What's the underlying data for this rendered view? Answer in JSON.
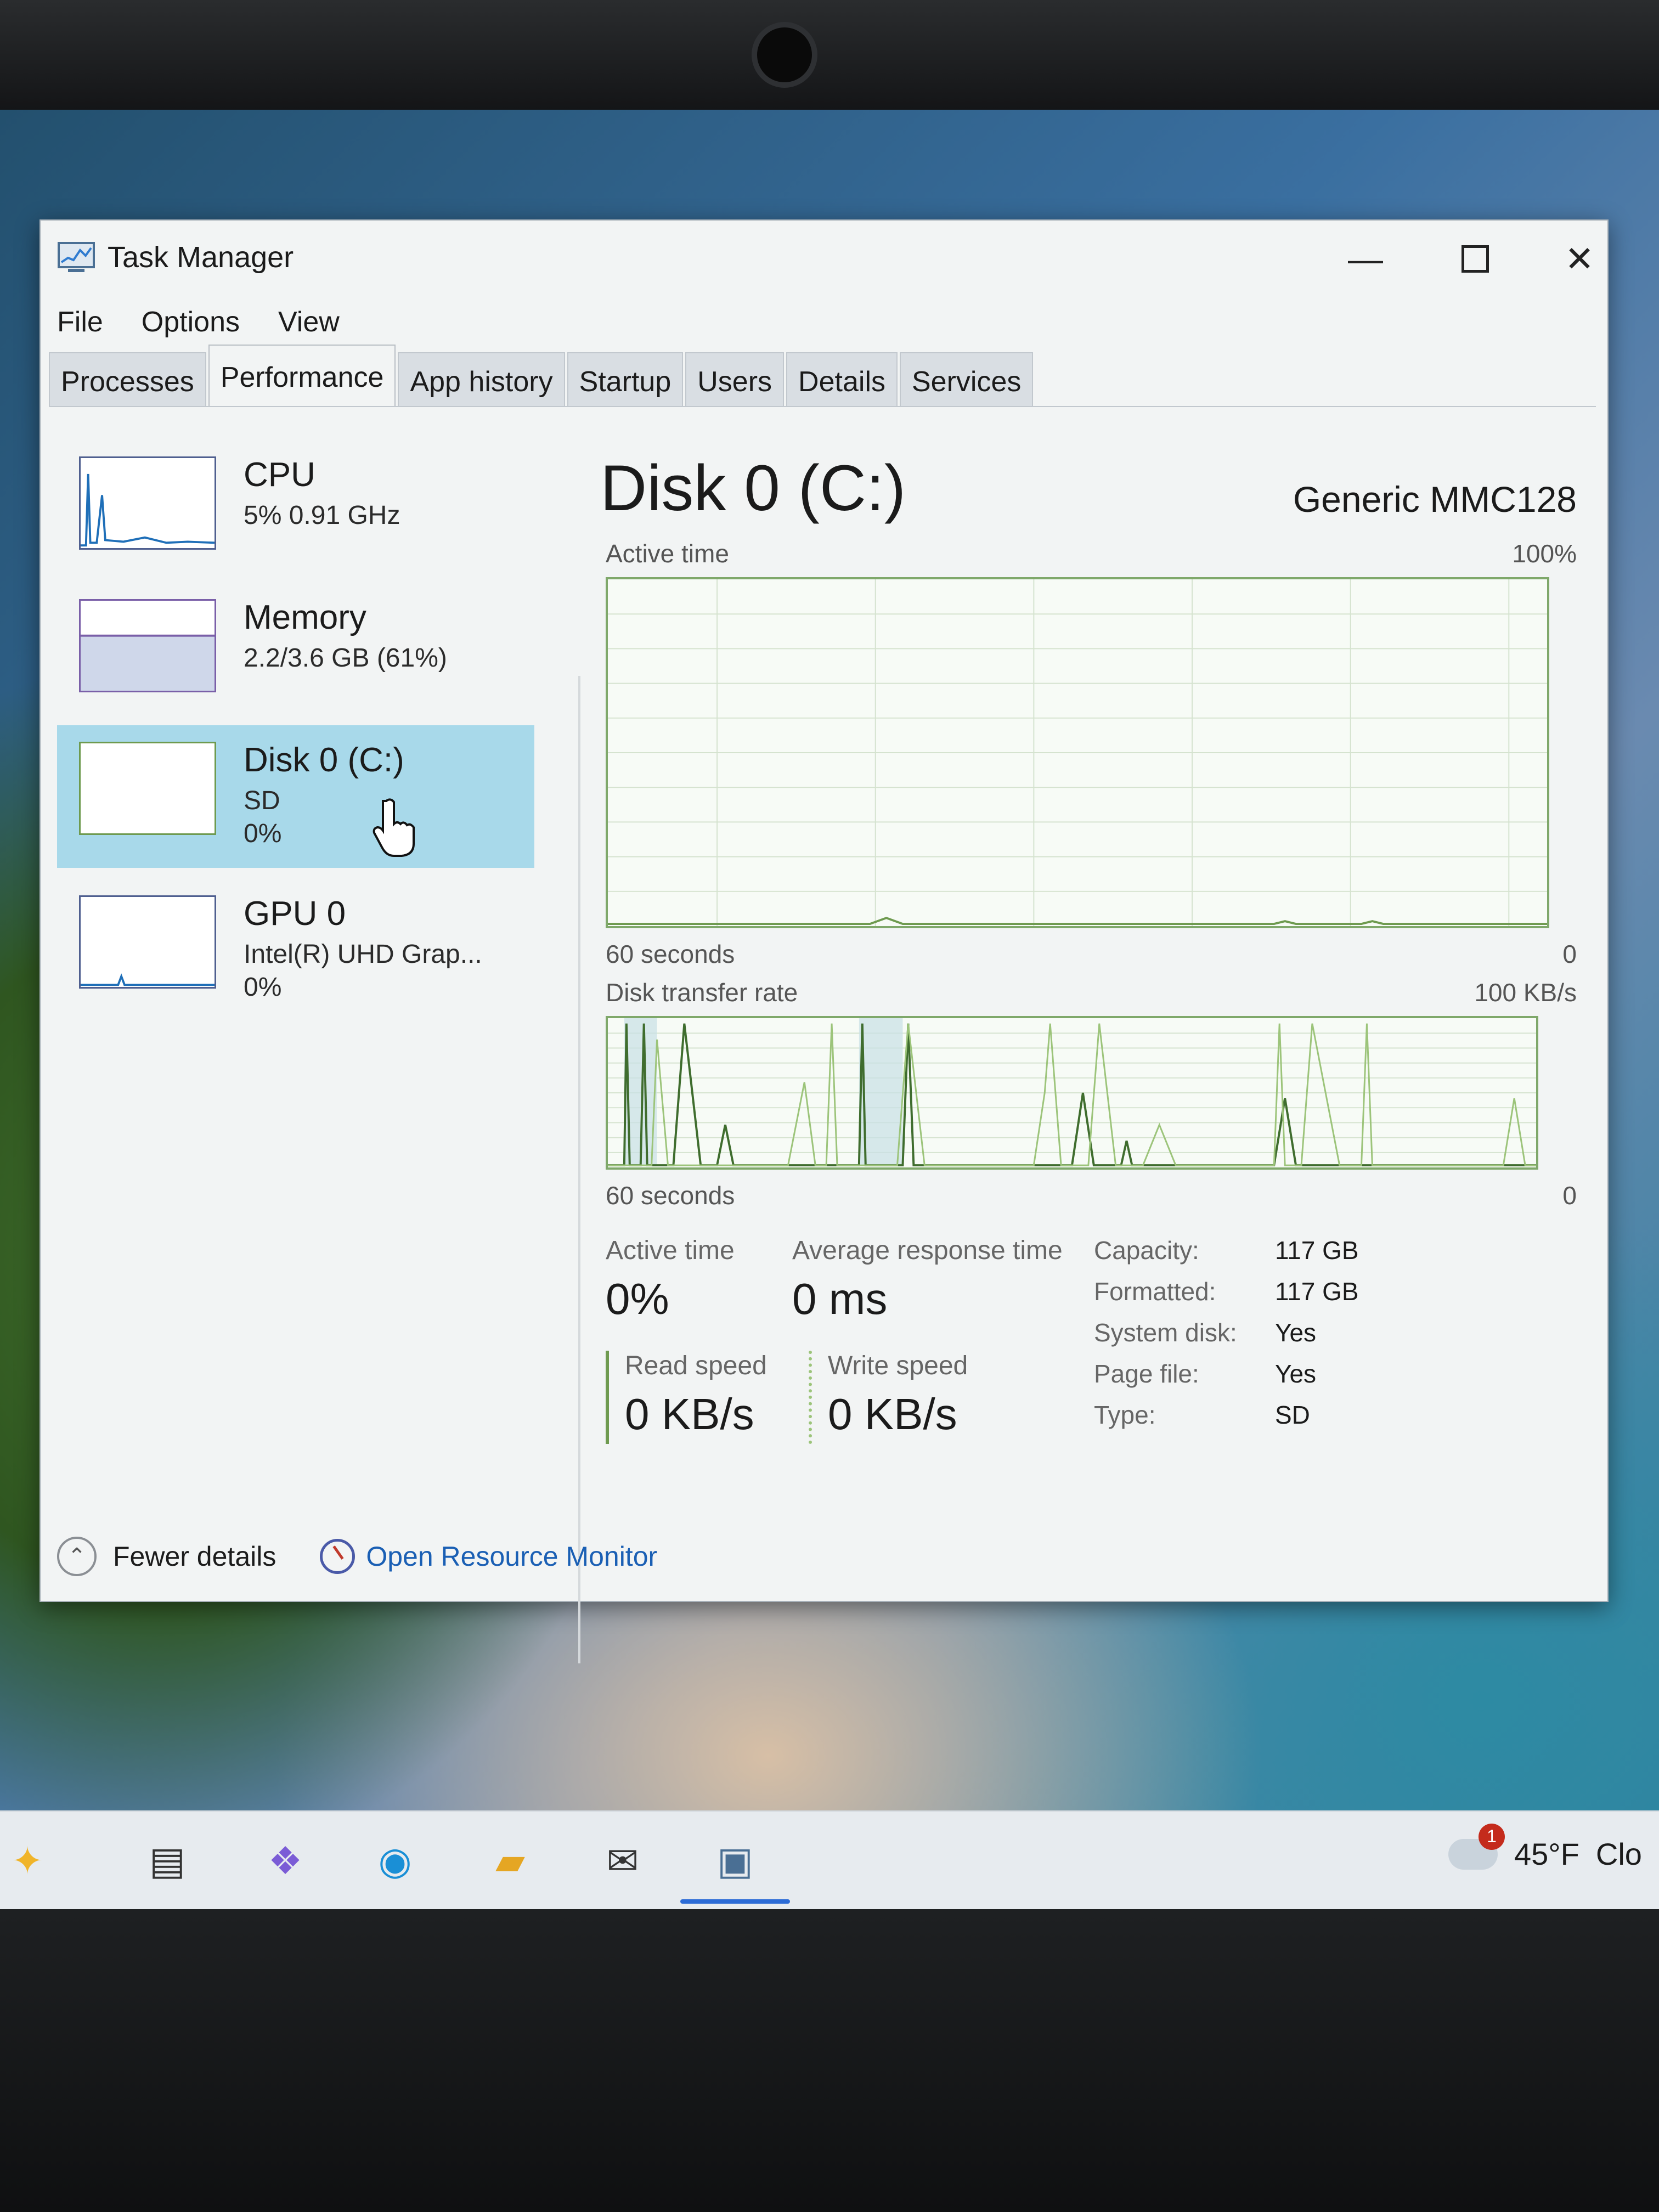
{
  "window": {
    "title": "Task Manager",
    "min_glyph": "—",
    "close_glyph": "✕"
  },
  "menu": [
    "File",
    "Options",
    "View"
  ],
  "tabs": [
    "Processes",
    "Performance",
    "App history",
    "Startup",
    "Users",
    "Details",
    "Services"
  ],
  "active_tab": "Performance",
  "sidebar": {
    "items": [
      {
        "title": "CPU",
        "line1": "5% 0.91 GHz",
        "line2": ""
      },
      {
        "title": "Memory",
        "line1": "2.2/3.6 GB (61%)",
        "line2": ""
      },
      {
        "title": "Disk 0 (C:)",
        "line1": "SD",
        "line2": "0%"
      },
      {
        "title": "GPU 0",
        "line1": "Intel(R) UHD Grap...",
        "line2": "0%"
      }
    ],
    "selected_index": 2
  },
  "detail": {
    "title": "Disk 0 (C:)",
    "model": "Generic MMC128",
    "active_graph": {
      "label": "Active time",
      "max": "100%",
      "time_label": "60 seconds",
      "min": "0"
    },
    "transfer_graph": {
      "label": "Disk transfer rate",
      "max": "100 KB/s",
      "time_label": "60 seconds",
      "min": "0"
    },
    "stats": {
      "active_time_label": "Active time",
      "active_time_value": "0%",
      "avg_response_label": "Average response time",
      "avg_response_value": "0 ms",
      "read_label": "Read speed",
      "read_value": "0 KB/s",
      "write_label": "Write speed",
      "write_value": "0 KB/s"
    },
    "properties": [
      {
        "label": "Capacity:",
        "value": "117 GB"
      },
      {
        "label": "Formatted:",
        "value": "117 GB"
      },
      {
        "label": "System disk:",
        "value": "Yes"
      },
      {
        "label": "Page file:",
        "value": "Yes"
      },
      {
        "label": "Type:",
        "value": "SD"
      }
    ]
  },
  "footer": {
    "fewer_details": "Fewer details",
    "resource_monitor": "Open Resource Monitor"
  },
  "taskbar": {
    "weather_temp": "45°F",
    "weather_text": "Clo",
    "weather_badge": "1"
  },
  "colors": {
    "selected_bg": "#a8d9ea",
    "disk_graph_line": "#6e9a4f",
    "link": "#1a5fb4"
  }
}
